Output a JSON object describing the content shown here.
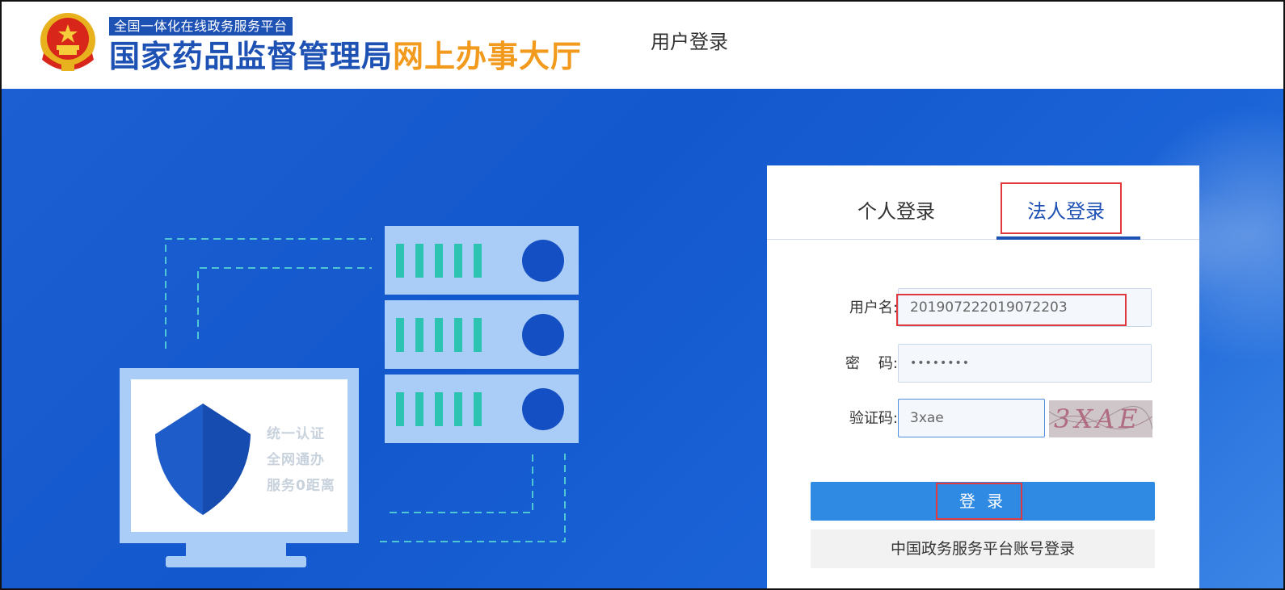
{
  "header": {
    "platform_tag": "全国一体化在线政务服务平台",
    "brand_main": "国家药品监督管理局",
    "brand_accent": "网上办事大厅",
    "page_heading": "用户登录"
  },
  "illustration": {
    "slogan_lines": [
      "统一认证",
      "全网通办",
      "服务0距离"
    ]
  },
  "login": {
    "tabs": [
      {
        "label": "个人登录",
        "active": false
      },
      {
        "label": "法人登录",
        "active": true
      }
    ],
    "username": {
      "label": "用户名:",
      "value": "201907222019072203"
    },
    "password": {
      "label": "密    码:",
      "value": "••••••••"
    },
    "captcha": {
      "label": "验证码:",
      "value": "3xae",
      "image_text": "3XAE"
    },
    "submit_label": "登 录",
    "alt_login_label": "中国政务服务平台账号登录"
  },
  "colors": {
    "brand_blue": "#1d51b4",
    "brand_orange": "#f29a1d",
    "hero_blue": "#1458cd",
    "button_blue": "#2f8ae3",
    "highlight_red": "#e0393e",
    "server_bar_teal": "#2cc3b1"
  },
  "icons": {
    "emblem": "national-emblem-icon",
    "shield": "shield-icon"
  }
}
